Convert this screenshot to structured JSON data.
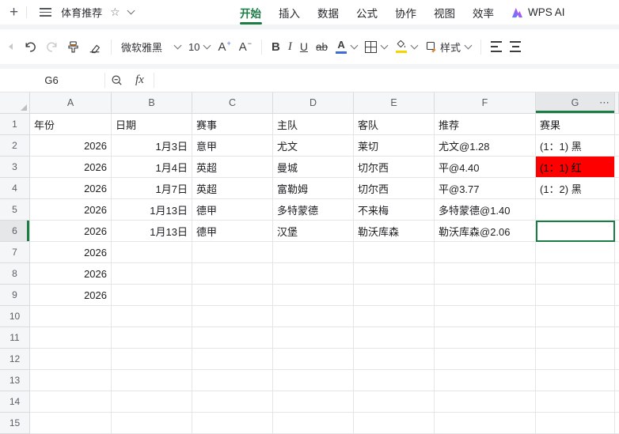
{
  "titlebar": {
    "new_tab": "+",
    "doc_title": "体育推荐"
  },
  "tabs": {
    "home": "开始",
    "insert": "插入",
    "data": "数据",
    "formulas": "公式",
    "collaborate": "协作",
    "view": "视图",
    "efficiency": "效率",
    "wps_ai": "WPS AI"
  },
  "toolbar": {
    "font_name": "微软雅黑",
    "font_size": "10",
    "bold": "B",
    "italic": "I",
    "underline": "U",
    "strikethrough": "ab",
    "font_color": "A",
    "grow_font": "A",
    "grow_font_sign": "+",
    "shrink_font": "A",
    "shrink_font_sign": "−",
    "styles": "样式"
  },
  "formula_bar": {
    "cell_ref": "G6",
    "fx": "fx"
  },
  "icons": {
    "star": "☆",
    "more_columns": "⋯"
  },
  "colors": {
    "accent_green": "#1B7C44",
    "fill_red": "#FF0000",
    "font_color_bar": "#3E6BD6",
    "fill_color_bar": "#F5D400"
  },
  "sheet": {
    "selected_cell": "G6",
    "col_headers": [
      "A",
      "B",
      "C",
      "D",
      "E",
      "F",
      "G"
    ],
    "row_numbers": [
      "1",
      "2",
      "3",
      "4",
      "5",
      "6",
      "7",
      "8",
      "9",
      "10",
      "11",
      "12",
      "13",
      "14",
      "15"
    ],
    "header_row": [
      "年份",
      "日期",
      "赛事",
      "主队",
      "客队",
      "推荐",
      "赛果"
    ],
    "rows": [
      {
        "a": "2026",
        "b": "1月3日",
        "c": "意甲",
        "d": "尤文",
        "e": "莱切",
        "f": "尤文@1.28",
        "g": "(1：1) 黑"
      },
      {
        "a": "2026",
        "b": "1月4日",
        "c": "英超",
        "d": "曼城",
        "e": "切尔西",
        "f": "平@4.40",
        "g": "(1：1) 红"
      },
      {
        "a": "2026",
        "b": "1月7日",
        "c": "英超",
        "d": "富勒姆",
        "e": "切尔西",
        "f": "平@3.77",
        "g": "(1：2) 黑"
      },
      {
        "a": "2026",
        "b": "1月13日",
        "c": "德甲",
        "d": "多特蒙德",
        "e": "不来梅",
        "f": "多特蒙德@1.40",
        "g": ""
      },
      {
        "a": "2026",
        "b": "1月13日",
        "c": "德甲",
        "d": "汉堡",
        "e": "勒沃库森",
        "f": "勒沃库森@2.06",
        "g": ""
      },
      {
        "a": "2026"
      },
      {
        "a": "2026"
      },
      {
        "a": "2026"
      }
    ]
  }
}
